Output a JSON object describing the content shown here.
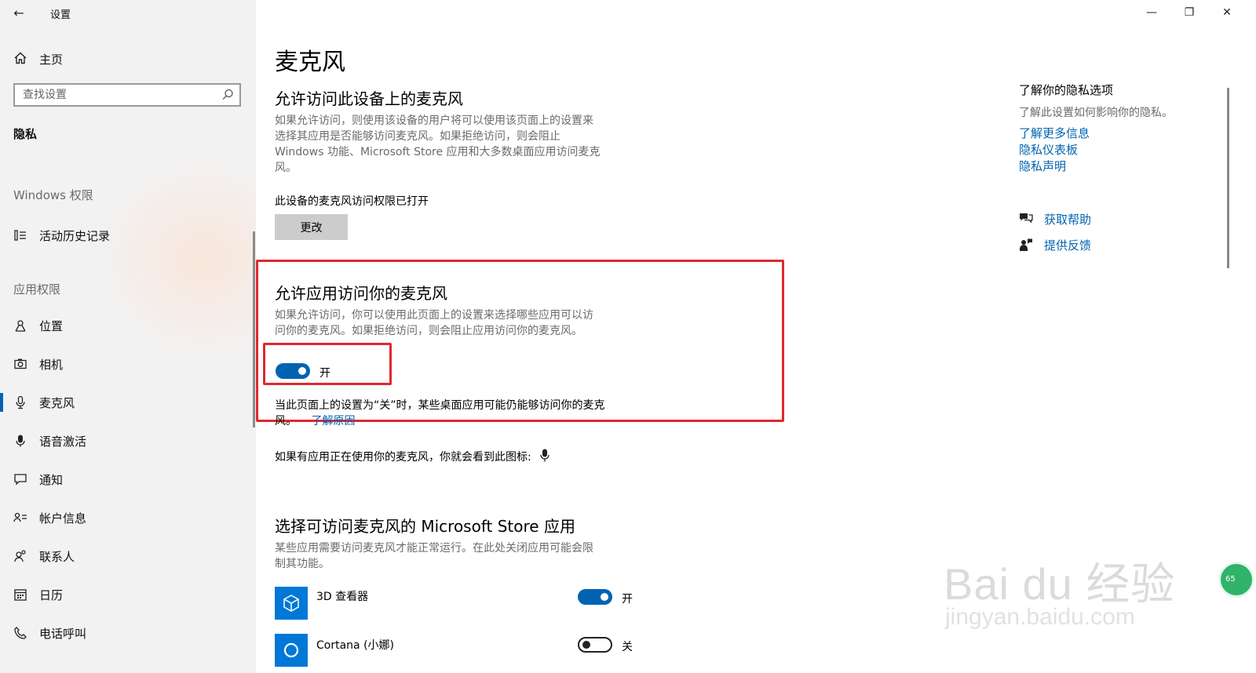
{
  "window": {
    "title": "设置",
    "back_glyph": "←",
    "min_glyph": "—",
    "restore_glyph": "❐",
    "close_glyph": "✕"
  },
  "sidebar": {
    "home_label": "主页",
    "search_placeholder": "查找设置",
    "section_title": "隐私",
    "group_windows": "Windows 权限",
    "windows_items": [
      {
        "label": "活动历史记录",
        "icon": "activity-history-icon"
      }
    ],
    "group_apps": "应用权限",
    "app_items": [
      {
        "label": "位置",
        "icon": "location-icon"
      },
      {
        "label": "相机",
        "icon": "camera-icon"
      },
      {
        "label": "麦克风",
        "icon": "microphone-icon",
        "active": true
      },
      {
        "label": "语音激活",
        "icon": "voice-activation-icon"
      },
      {
        "label": "通知",
        "icon": "notification-icon"
      },
      {
        "label": "帐户信息",
        "icon": "account-info-icon"
      },
      {
        "label": "联系人",
        "icon": "contacts-icon"
      },
      {
        "label": "日历",
        "icon": "calendar-icon"
      },
      {
        "label": "电话呼叫",
        "icon": "phone-icon"
      }
    ]
  },
  "main": {
    "page_title": "麦克风",
    "device_section": {
      "heading": "允许访问此设备上的麦克风",
      "desc_lines": [
        "如果允许访问，则使用该设备的用户将可以使用该页面上的设置来",
        "选择其应用是否能够访问麦克风。如果拒绝访问，则会阻止",
        "Windows 功能、Microsoft Store 应用和大多数桌面应用访问麦克",
        "风。"
      ],
      "status": "此设备的麦克风访问权限已打开",
      "change_button": "更改"
    },
    "app_section": {
      "heading": "允许应用访问你的麦克风",
      "desc_lines": [
        "如果允许访问，你可以使用此页面上的设置来选择哪些应用可以访",
        "问你的麦克风。如果拒绝访问，则会阻止应用访问你的麦克风。"
      ],
      "toggle_state": "on",
      "toggle_label": "开",
      "note_line1": "当此页面上的设置为“关”时，某些桌面应用可能仍能够访问你的麦克",
      "note_line2": "风。",
      "note_link": "了解原因",
      "icon_note": "如果有应用正在使用你的麦克风，你就会看到此图标:"
    },
    "store_section": {
      "heading": "选择可访问麦克风的 Microsoft Store 应用",
      "desc_lines": [
        "某些应用需要访问麦克风才能正常运行。在此处关闭应用可能会限",
        "制其功能。"
      ],
      "apps": [
        {
          "name": "3D 查看器",
          "icon": "3d-viewer-icon",
          "state": "on",
          "state_label": "开"
        },
        {
          "name": "Cortana (小娜)",
          "icon": "cortana-icon",
          "state": "off",
          "state_label": "关"
        }
      ]
    }
  },
  "right_column": {
    "title": "了解你的隐私选项",
    "desc": "了解此设置如何影响你的隐私。",
    "links": [
      "了解更多信息",
      "隐私仪表板",
      "隐私声明"
    ],
    "help_label": "获取帮助",
    "feedback_label": "提供反馈"
  },
  "watermark": {
    "brand": "Bai du 经验",
    "url": "jingyan.baidu.com",
    "badge": "65"
  },
  "colors": {
    "accent": "#0063b1",
    "highlight": "#e0282f",
    "sidebar_bg": "#f2f2f2"
  }
}
